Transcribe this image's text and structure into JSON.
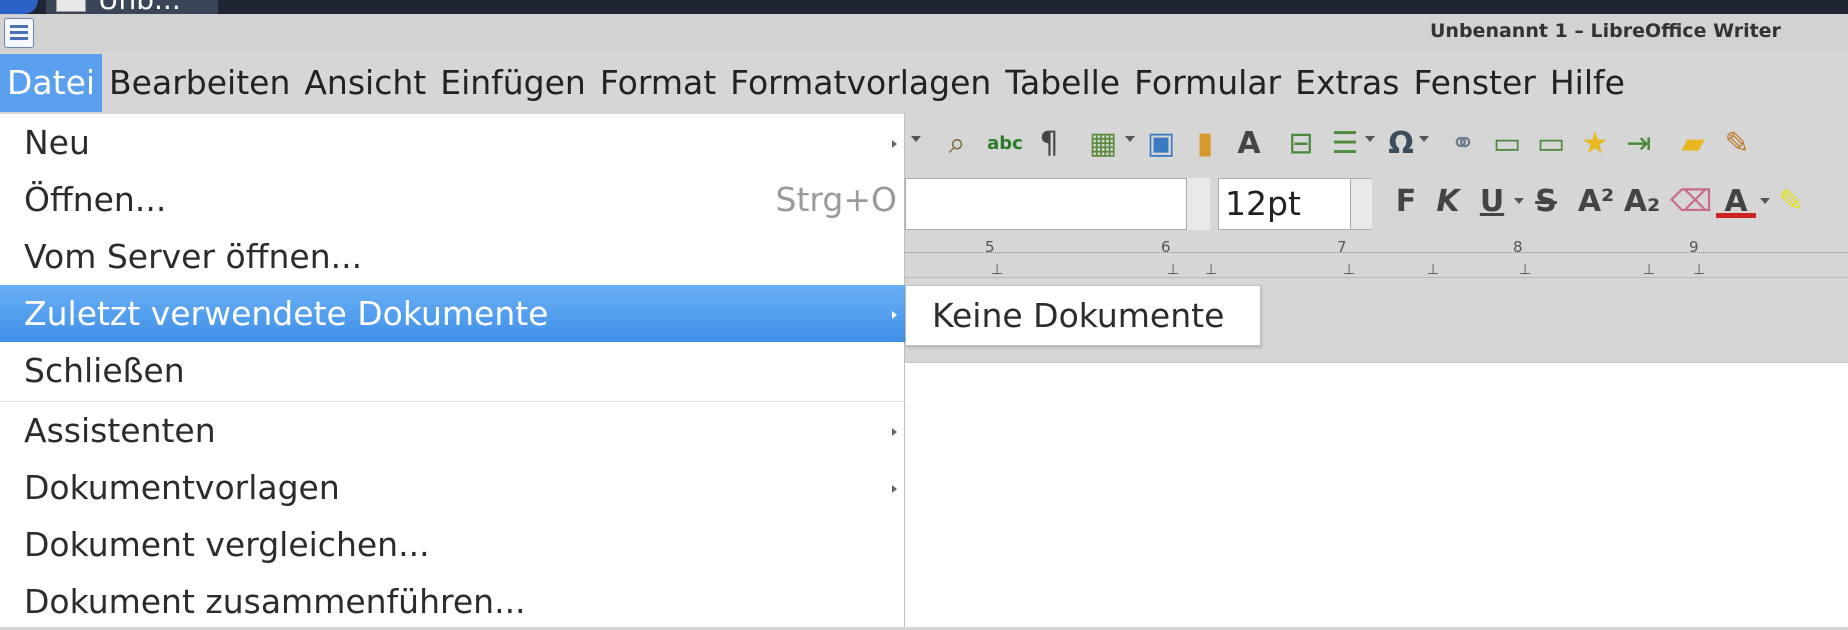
{
  "taskbar": {
    "task_label": "Unb..."
  },
  "window": {
    "title": "Unbenannt 1 – LibreOffice Writer"
  },
  "menubar": {
    "items": [
      {
        "label": "Datei"
      },
      {
        "label": "Bearbeiten"
      },
      {
        "label": "Ansicht"
      },
      {
        "label": "Einfügen"
      },
      {
        "label": "Format"
      },
      {
        "label": "Formatvorlagen"
      },
      {
        "label": "Tabelle"
      },
      {
        "label": "Formular"
      },
      {
        "label": "Extras"
      },
      {
        "label": "Fenster"
      },
      {
        "label": "Hilfe"
      }
    ]
  },
  "toolbar": {
    "font_size": "12pt",
    "icons": [
      "find-replace-icon",
      "spellcheck-icon",
      "formatting-marks-icon",
      "insert-table-icon",
      "insert-image-icon",
      "insert-chart-icon",
      "insert-textbox-icon",
      "insert-pagebreak-icon",
      "insert-field-icon",
      "special-character-icon",
      "hyperlink-icon",
      "footnote-icon",
      "endnote-icon",
      "bookmark-icon",
      "cross-reference-icon",
      "comment-icon",
      "track-changes-icon",
      "bold-icon",
      "italic-icon",
      "underline-icon",
      "strikethrough-icon",
      "superscript-icon",
      "subscript-icon",
      "clear-formatting-icon",
      "font-color-icon",
      "highlight-icon"
    ],
    "format_letters": {
      "bold": "F",
      "italic": "K",
      "underline": "U",
      "strike": "S"
    }
  },
  "ruler": {
    "numbers": [
      "5",
      "6",
      "7",
      "8",
      "9"
    ]
  },
  "file_menu": {
    "items": [
      {
        "label": "Neu",
        "submenu": true
      },
      {
        "label": "Öffnen...",
        "shortcut": "Strg+O"
      },
      {
        "label": "Vom Server öffnen..."
      },
      {
        "label": "Zuletzt verwendete Dokumente",
        "submenu": true,
        "highlighted": true
      },
      {
        "label": "Schließen"
      },
      {
        "label": "Assistenten",
        "submenu": true
      },
      {
        "label": "Dokumentvorlagen",
        "submenu": true
      },
      {
        "label": "Dokument vergleichen..."
      },
      {
        "label": "Dokument zusammenführen..."
      }
    ]
  },
  "recent_submenu": {
    "empty_label": "Keine Dokumente"
  },
  "colors": {
    "highlight": "#4a98ec",
    "menubar_active": "#5aa0ee",
    "background": "#d6d6d6"
  }
}
